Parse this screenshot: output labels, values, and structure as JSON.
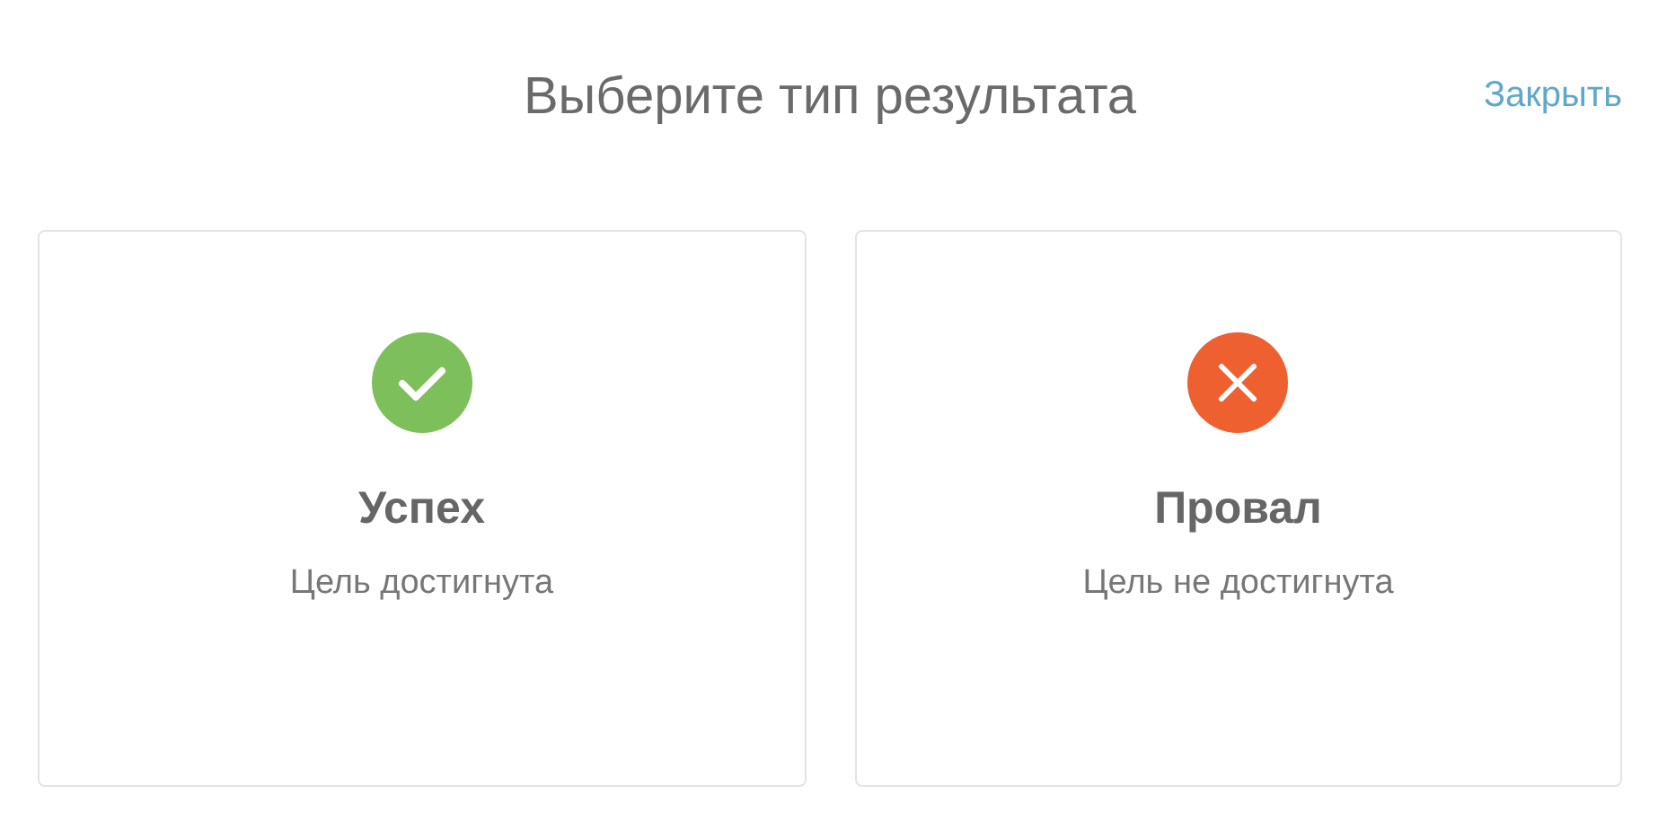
{
  "header": {
    "title": "Выберите тип результата",
    "close_link": "Закрыть"
  },
  "options": [
    {
      "kind": "success",
      "color": "#7dbf5a",
      "title": "Успех",
      "subtitle": "Цель достигнута"
    },
    {
      "kind": "failure",
      "color": "#ee6030",
      "title": "Провал",
      "subtitle": "Цель не достигнута"
    }
  ]
}
